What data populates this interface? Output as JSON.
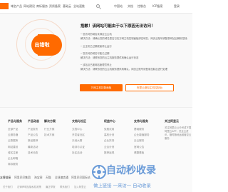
{
  "nav": {
    "brand": "阿里云",
    "items": [
      "域名产品",
      "网站建设",
      "商标服务",
      "资质备案",
      "基础云",
      "全站速推"
    ],
    "search_label": "",
    "right_items": [
      "中国站",
      "文档",
      "控制台",
      "ICP备案",
      "登录"
    ]
  },
  "error": {
    "badge": "出错啦",
    "title": "抱歉！该网站可能由于以下原因无法访问！",
    "lines": [
      {
        "text": "您访问的域名未绑定云主机",
        "bullet": true
      },
      {
        "text": "解决方法：请确认您的域名是否已在万网主机控制面板绑定域名，网页云账号请登录网站云解析控制台检查",
        "bullet": false
      },
      {
        "text": "云主机已过期或者停止运行",
        "bullet": true
      },
      {
        "text": "您访问的域名可能已过期",
        "bullet": true
      },
      {
        "text": "解决方法：请联系您的云主机服务提供商确认运行状态",
        "bullet": false
      },
      {
        "text": "该站点已被网站管理员停止",
        "bullet": true
      },
      {
        "text": "解决方法：请联系您的云主机服务提供商确认，网页云账号请登录控制台进行处理",
        "bullet": false
      }
    ],
    "primary_button": "万网主机控制面板",
    "secondary_button": "阿里云虚拟主机控制台"
  },
  "footer": {
    "columns": [
      {
        "title": "产品与服务",
        "items": [
          "全部产品",
          "云服务器",
          "云数据库",
          "网站建设",
          "域名注册",
          "企业邮箱",
          "商标服务"
        ]
      },
      {
        "title": "产品动态",
        "items": [
          "产品发布",
          "产品公告",
          "新品推荐",
          "最新活动",
          "技术动态"
        ]
      },
      {
        "title": "解决方案",
        "items": [
          "行业方案",
          "技术方案"
        ]
      },
      {
        "title": "文档与社区",
        "items": [
          "文档中心",
          "开发者社区",
          "天池大赛",
          "培训与认证",
          "社区活动"
        ]
      },
      {
        "title": "权益中心",
        "items": [
          "免费试用",
          "高校计划",
          "企业扶持",
          "云合计划",
          "推荐返现"
        ]
      },
      {
        "title": "支持与服务",
        "items": [
          "基础服务",
          "企业增值服务",
          "迁云服务",
          "官网公告",
          "健康看板"
        ]
      },
      {
        "title": "关注阿里云",
        "items": []
      }
    ],
    "follow_desc": "关注阿里云公众号或下载阿里云APP，关注云资讯，随时随地运维管控云服务",
    "friendlinks_label": "友情链接",
    "friendlinks": [
      "阿里巴巴集团",
      "淘宝网",
      "天猫",
      "全球速卖通",
      "阿里巴巴国际站",
      "1688",
      "闲鱼",
      "优酷",
      "钉钉"
    ],
    "bottom": [
      "关于我们",
      "法律声明及隐私权政策",
      "廉正举报",
      "联系我们",
      "加入阿里云"
    ]
  },
  "watermark": {
    "title": "自动秒收录",
    "subtitle": "做上链接 一来访一 自动收录"
  },
  "colors": {
    "accent": "#ff6a00",
    "watermark": "#6a9bd8"
  }
}
